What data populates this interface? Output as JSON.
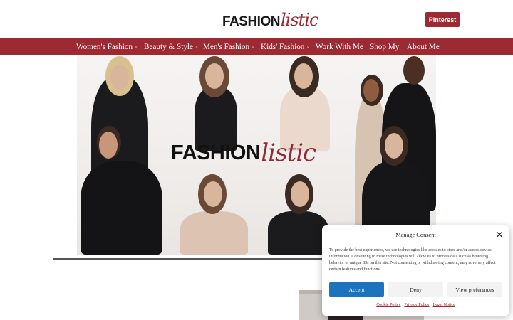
{
  "header": {
    "logo_main": "FASHION",
    "logo_script": "listic",
    "pinterest_label": "Pinterest"
  },
  "nav": {
    "items": [
      {
        "label": "Women's Fashion",
        "has_dropdown": true
      },
      {
        "label": "Beauty & Style",
        "has_dropdown": true
      },
      {
        "label": "Men's Fashion",
        "has_dropdown": true
      },
      {
        "label": "Kids' Fashion",
        "has_dropdown": true
      },
      {
        "label": "Work With Me",
        "has_dropdown": false
      },
      {
        "label": "Shop My",
        "has_dropdown": false
      },
      {
        "label": "About Me",
        "has_dropdown": false
      }
    ],
    "chevron": "˅"
  },
  "hero": {
    "word_main": "FASHION",
    "word_script": "listic"
  },
  "consent": {
    "title": "Manage Consent",
    "close_icon": "✕",
    "body": "To provide the best experiences, we use technologies like cookies to store and/or access device information. Consenting to these technologies will allow us to process data such as browsing behavior or unique IDs on this site. Not consenting or withdrawing consent, may adversely affect certain features and functions.",
    "accept_label": "Accept",
    "deny_label": "Deny",
    "view_label": "View preferences",
    "links": [
      "Cookie Policy",
      "Privacy Policy",
      "Legal Notice"
    ]
  },
  "colors": {
    "brand": "#9b2a33",
    "accept": "#1e73be"
  }
}
